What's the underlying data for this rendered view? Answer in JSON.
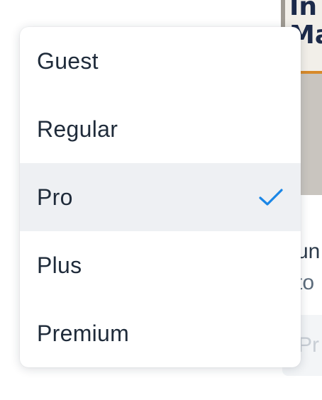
{
  "background": {
    "thumbnail_text_line1": "In",
    "thumbnail_text_line2": "Ma",
    "text_line1": "un",
    "text_line2": "to",
    "pill_text": "Pr"
  },
  "menu": {
    "selected_index": 2,
    "items": [
      {
        "label": "Guest",
        "selected": false
      },
      {
        "label": "Regular",
        "selected": false
      },
      {
        "label": "Pro",
        "selected": true
      },
      {
        "label": "Plus",
        "selected": false
      },
      {
        "label": "Premium",
        "selected": false
      }
    ],
    "check_icon": "checkmark-icon",
    "accent_color": "#1a86e6",
    "selected_background": "#eef0f3"
  }
}
